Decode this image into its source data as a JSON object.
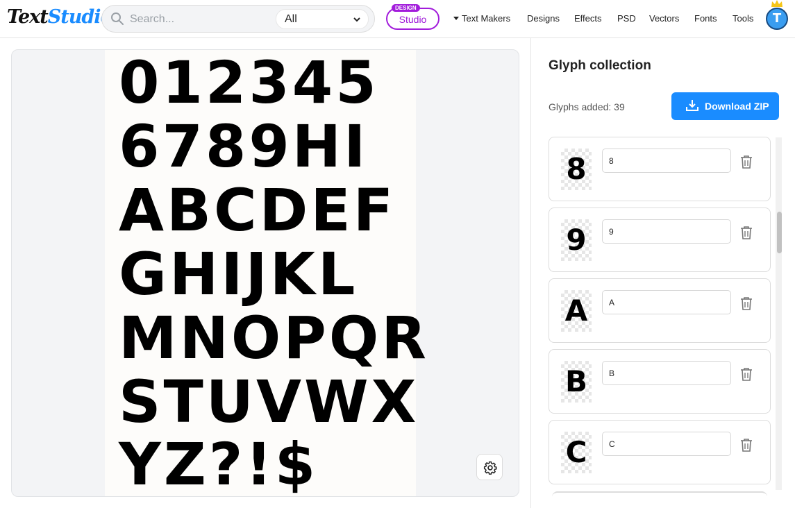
{
  "header": {
    "logo_part1": "Text",
    "logo_part2": "Studio",
    "search_placeholder": "Search...",
    "search_scope": "All",
    "studio_badge": "DESIGN",
    "studio_label": "Studio",
    "nav": [
      "Text Makers",
      "Designs",
      "Effects",
      "PSD",
      "Vectors",
      "Fonts",
      "Tools"
    ],
    "avatar_letter": "T"
  },
  "canvas": {
    "rows": [
      "012345",
      "6789HI",
      "ABCDEF",
      "GHIJKL",
      "MNOPQR",
      "STUVWX",
      "YZ?!$"
    ]
  },
  "panel": {
    "title": "Glyph collection",
    "count_label": "Glyphs added: 39",
    "download_label": "Download ZIP",
    "glyphs": [
      {
        "char": "8",
        "value": "8"
      },
      {
        "char": "9",
        "value": "9"
      },
      {
        "char": "A",
        "value": "A"
      },
      {
        "char": "B",
        "value": "B"
      },
      {
        "char": "C",
        "value": "C"
      }
    ]
  },
  "colors": {
    "accent": "#1a8cff",
    "studio": "#a21cdb"
  },
  "icons": {
    "search": "search-icon",
    "dropdown": "chevron-down-icon",
    "settings": "gear-icon",
    "download": "download-icon",
    "delete": "trash-icon",
    "crown": "crown-icon"
  }
}
